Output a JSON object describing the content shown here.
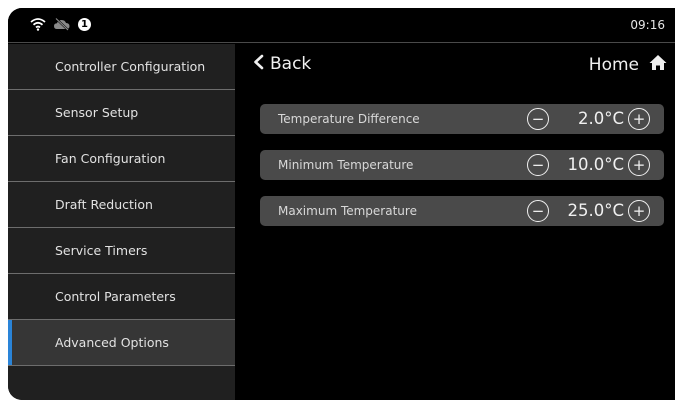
{
  "status_bar": {
    "icons": [
      "wifi-icon",
      "cloud-off-icon",
      "alert-badge-icon"
    ],
    "badge_text": "1",
    "clock": "09:16"
  },
  "sidebar": {
    "items": [
      {
        "label": "Controller Configuration"
      },
      {
        "label": "Sensor Setup"
      },
      {
        "label": "Fan Configuration"
      },
      {
        "label": "Draft Reduction"
      },
      {
        "label": "Service Timers"
      },
      {
        "label": "Control Parameters"
      },
      {
        "label": "Advanced Options",
        "active": true
      }
    ],
    "accent_color": "#2a84d8"
  },
  "header": {
    "back_label": "Back",
    "home_label": "Home"
  },
  "settings": [
    {
      "label": "Temperature Difference",
      "value": "2.0°C"
    },
    {
      "label": "Minimum Temperature",
      "value": "10.0°C"
    },
    {
      "label": "Maximum Temperature",
      "value": "25.0°C"
    }
  ],
  "controls": {
    "minus_symbol": "−",
    "plus_symbol": "+"
  }
}
